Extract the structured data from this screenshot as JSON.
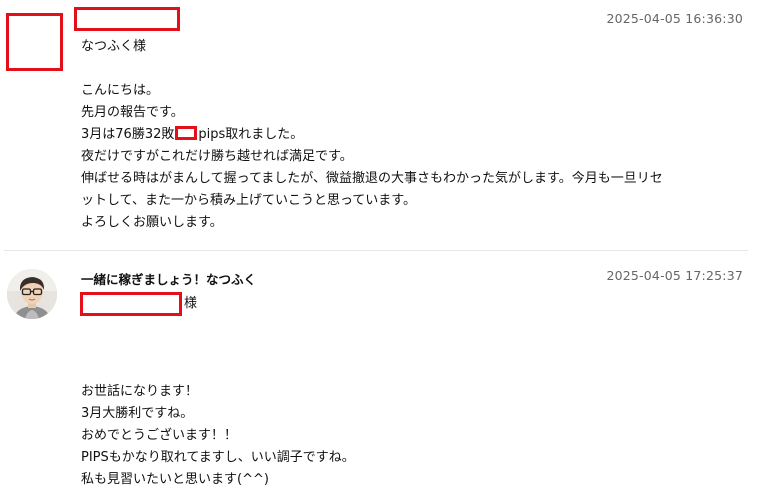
{
  "comments": [
    {
      "timestamp": "2025-04-05 16:36:30",
      "greeting": "なつふく様",
      "lines": [
        "こんにちは。",
        "先月の報告です。",
        "3月は76勝32敗",
        "pips取れました。",
        "夜だけですがこれだけ勝ち越せれば満足です。",
        "伸ばせる時はがまんして握ってましたが、微益撤退の大事さもわかった気がします。今月も一旦リセ",
        "ットして、また一から積み上げていこうと思っています。",
        "よろしくお願いします。"
      ]
    },
    {
      "author": "一緒に稼ぎましょう！なつふく",
      "timestamp": "2025-04-05 17:25:37",
      "salutation_suffix": "様",
      "lines": [
        "お世話になります！",
        "3月大勝利ですね。",
        "おめでとうございます！！",
        "PIPSもかなり取れてますし、いい調子ですね。",
        "私も見習いたいと思います(^^)"
      ]
    }
  ],
  "colors": {
    "redaction": "#e3101b",
    "timestamp": "#666666",
    "divider": "#e6e6e6"
  }
}
